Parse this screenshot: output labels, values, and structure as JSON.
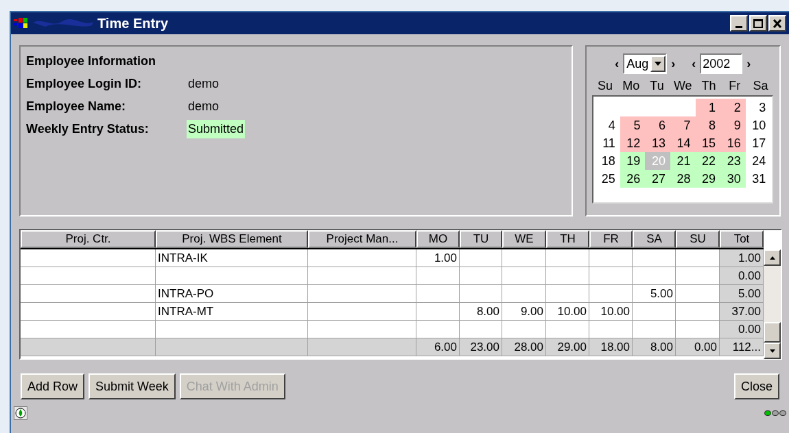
{
  "window": {
    "title": "Time Entry"
  },
  "employee_info": {
    "heading": "Employee Information",
    "fields": [
      {
        "label": "Employee Login ID:",
        "value": "demo",
        "highlight": false
      },
      {
        "label": "Employee Name:",
        "value": "demo",
        "highlight": false
      },
      {
        "label": "Weekly Entry Status:",
        "value": "Submitted",
        "highlight": true
      }
    ]
  },
  "calendar": {
    "month": "Aug",
    "year": "2002",
    "prev": "‹",
    "next": "›",
    "weekdays": [
      "Su",
      "Mo",
      "Tu",
      "We",
      "Th",
      "Fr",
      "Sa"
    ],
    "weeks": [
      [
        {
          "kind": "blank"
        },
        {
          "kind": "blank"
        },
        {
          "kind": "blank"
        },
        {
          "kind": "blank"
        },
        {
          "kind": "day",
          "day": "1",
          "color": "#ffc0c0",
          "selected": false
        },
        {
          "kind": "day",
          "day": "2",
          "color": "#ffc0c0",
          "selected": false
        },
        {
          "kind": "day",
          "day": "3",
          "color": "#ffffff",
          "selected": false
        }
      ],
      [
        {
          "kind": "day",
          "day": "4",
          "color": "#ffffff",
          "selected": false
        },
        {
          "kind": "day",
          "day": "5",
          "color": "#ffc0c0",
          "selected": false
        },
        {
          "kind": "day",
          "day": "6",
          "color": "#ffc0c0",
          "selected": false
        },
        {
          "kind": "day",
          "day": "7",
          "color": "#ffc0c0",
          "selected": false
        },
        {
          "kind": "day",
          "day": "8",
          "color": "#ffc0c0",
          "selected": false
        },
        {
          "kind": "day",
          "day": "9",
          "color": "#ffc0c0",
          "selected": false
        },
        {
          "kind": "day",
          "day": "10",
          "color": "#ffffff",
          "selected": false
        }
      ],
      [
        {
          "kind": "day",
          "day": "11",
          "color": "#ffffff",
          "selected": false
        },
        {
          "kind": "day",
          "day": "12",
          "color": "#ffc0c0",
          "selected": false
        },
        {
          "kind": "day",
          "day": "13",
          "color": "#ffc0c0",
          "selected": false
        },
        {
          "kind": "day",
          "day": "14",
          "color": "#ffc0c0",
          "selected": false
        },
        {
          "kind": "day",
          "day": "15",
          "color": "#ffc0c0",
          "selected": false
        },
        {
          "kind": "day",
          "day": "16",
          "color": "#ffc0c0",
          "selected": false
        },
        {
          "kind": "day",
          "day": "17",
          "color": "#ffffff",
          "selected": false
        }
      ],
      [
        {
          "kind": "day",
          "day": "18",
          "color": "#ffffff",
          "selected": false
        },
        {
          "kind": "day",
          "day": "19",
          "color": "#c0ffc0",
          "selected": false
        },
        {
          "kind": "day",
          "day": "20",
          "color": "#c0c0c0",
          "selected": true
        },
        {
          "kind": "day",
          "day": "21",
          "color": "#c0ffc0",
          "selected": false
        },
        {
          "kind": "day",
          "day": "22",
          "color": "#c0ffc0",
          "selected": false
        },
        {
          "kind": "day",
          "day": "23",
          "color": "#c0ffc0",
          "selected": false
        },
        {
          "kind": "day",
          "day": "24",
          "color": "#ffffff",
          "selected": false
        }
      ],
      [
        {
          "kind": "day",
          "day": "25",
          "color": "#ffffff",
          "selected": false
        },
        {
          "kind": "day",
          "day": "26",
          "color": "#c0ffc0",
          "selected": false
        },
        {
          "kind": "day",
          "day": "27",
          "color": "#c0ffc0",
          "selected": false
        },
        {
          "kind": "day",
          "day": "28",
          "color": "#c0ffc0",
          "selected": false
        },
        {
          "kind": "day",
          "day": "29",
          "color": "#c0ffc0",
          "selected": false
        },
        {
          "kind": "day",
          "day": "30",
          "color": "#c0ffc0",
          "selected": false
        },
        {
          "kind": "day",
          "day": "31",
          "color": "#ffffff",
          "selected": false
        }
      ]
    ]
  },
  "table": {
    "columns": [
      "Proj. Ctr.",
      "Proj. WBS Element",
      "Project Man...",
      "MO",
      "TU",
      "WE",
      "TH",
      "FR",
      "SA",
      "SU",
      "Tot"
    ],
    "rows": [
      {
        "wbs": "INTRA-IK",
        "mo": "1.00",
        "tot": "1.00"
      },
      {
        "tot": "0.00"
      },
      {
        "wbs": "INTRA-PO",
        "sa": "5.00",
        "tot": "5.00"
      },
      {
        "wbs": "INTRA-MT",
        "tu": "8.00",
        "we": "9.00",
        "th": "10.00",
        "fr": "10.00",
        "tot": "37.00"
      },
      {
        "tot": "0.00"
      }
    ],
    "totals": {
      "mo": "6.00",
      "tu": "23.00",
      "we": "28.00",
      "th": "29.00",
      "fr": "18.00",
      "sa": "8.00",
      "su": "0.00",
      "tot": "112..."
    }
  },
  "buttons": [
    {
      "label": "Add Row",
      "disabled": false
    },
    {
      "label": "Submit Week",
      "disabled": false
    },
    {
      "label": "Chat With Admin",
      "disabled": true
    }
  ],
  "close_button": "Close",
  "status_lights": [
    {
      "color": "#00c000"
    },
    {
      "color": "#a0a0a0"
    },
    {
      "color": "#a0a0a0"
    }
  ]
}
